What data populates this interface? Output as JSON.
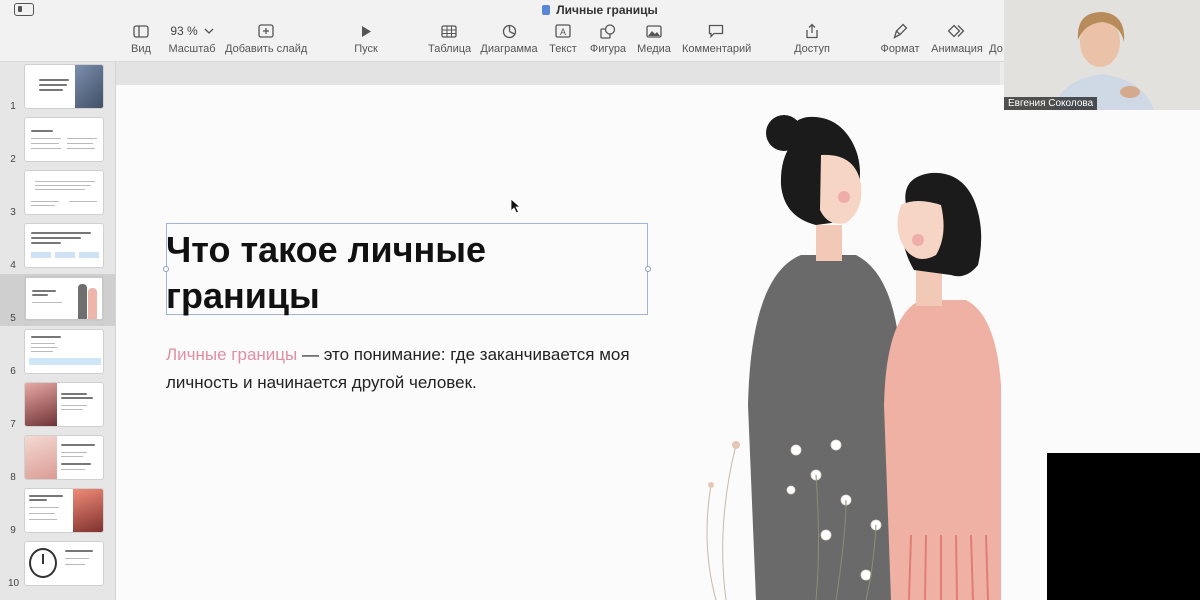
{
  "app": {
    "document_title": "Личные границы"
  },
  "toolbar": {
    "view_label": "Вид",
    "zoom_value": "93 %",
    "zoom_label": "Масштаб",
    "add_slide_label": "Добавить слайд",
    "play_label": "Пуск",
    "table_label": "Таблица",
    "chart_label": "Диаграмма",
    "text_label": "Текст",
    "shape_label": "Фигура",
    "media_label": "Медиа",
    "comment_label": "Комментарий",
    "share_label": "Доступ",
    "format_label": "Формат",
    "animate_label": "Анимация",
    "document_label": "До"
  },
  "navigator": {
    "slides": [
      {
        "number": "1"
      },
      {
        "number": "2"
      },
      {
        "number": "3"
      },
      {
        "number": "4"
      },
      {
        "number": "5"
      },
      {
        "number": "6"
      },
      {
        "number": "7"
      },
      {
        "number": "8"
      },
      {
        "number": "9"
      },
      {
        "number": "10"
      }
    ],
    "active_slide": "5"
  },
  "slide": {
    "title": "Что такое личные границы",
    "body_accent": "Личные границы",
    "body_rest": " — это понимание: где заканчивается моя личность и начинается другой человек."
  },
  "webcam": {
    "participant_name": "Евгения Соколова"
  },
  "colors": {
    "accent_pink": "#e08fa3",
    "selection_blue": "#9fb5d6"
  }
}
